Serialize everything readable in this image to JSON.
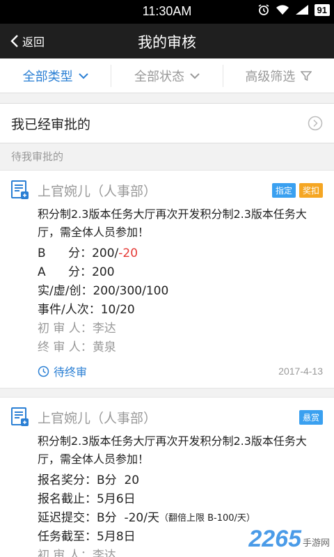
{
  "status_bar": {
    "time": "11:30AM",
    "battery": "91"
  },
  "nav": {
    "back_label": "返回",
    "title": "我的审核"
  },
  "filters": [
    {
      "label": "全部类型"
    },
    {
      "label": "全部状态"
    },
    {
      "label": "高级筛选"
    }
  ],
  "approved_row": {
    "label": "我已经审批的"
  },
  "section_label": "待我审批的",
  "cards": [
    {
      "name": "上官婉儿（人事部）",
      "tags": [
        "指定",
        "奖扣"
      ],
      "desc": "积分制2.3版本任务大厅再次开发积分制2.3版本任务大厅，需全体人员参加！",
      "b_label": "B      分：",
      "b_value": "200/",
      "b_neg": "-20",
      "a_label": "A      分：",
      "a_value": "200",
      "real_label": "实/虚/创：",
      "real_value": "200/300/100",
      "event_label": "事件/人次：",
      "event_value": "10/20",
      "first_label": "初 审 人：",
      "first_value": "李达",
      "final_label": "终 审 人：",
      "final_value": "黄泉",
      "status": "待终审",
      "date": "2017-4-13"
    },
    {
      "name": "上官婉儿（人事部）",
      "tags": [
        "悬赏"
      ],
      "desc": "积分制2.3版本任务大厅再次开发积分制2.3版本任务大厅，需全体人员参加！",
      "reward_label": "报名奖分：",
      "reward_value": "B分  20",
      "deadline_label": "报名截止：",
      "deadline_value": "5月6日",
      "delay_label": "延迟提交：",
      "delay_value": "B分  -20/天",
      "delay_note": "（翻倍上限 B-100/天）",
      "task_label": "任务截至：",
      "task_value": "5月8日",
      "first_label": "初 审 人：",
      "first_value": "李达"
    }
  ],
  "watermark": {
    "big": "2265",
    "small": "手游网"
  },
  "colors": {
    "accent": "#2a7fd4",
    "tag_blue": "#3aa0f0",
    "tag_orange": "#f5a623",
    "negative": "#e53935"
  }
}
